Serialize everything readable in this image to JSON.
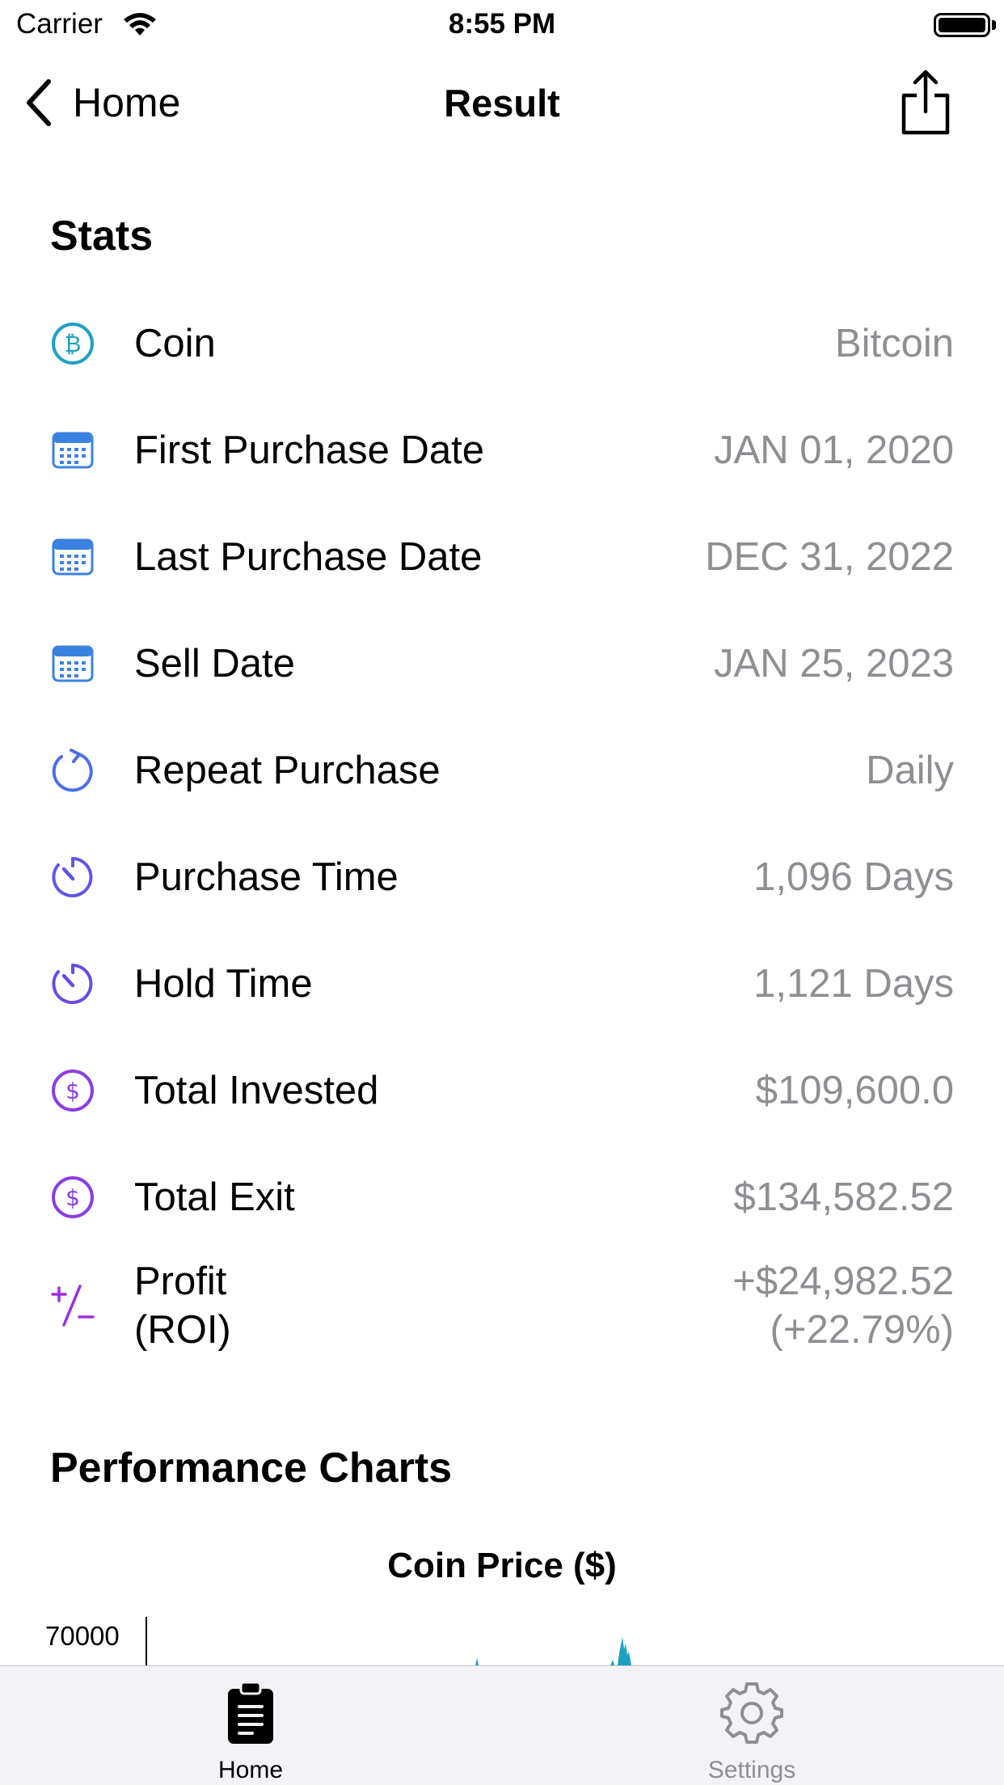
{
  "status_bar": {
    "carrier": "Carrier",
    "time": "8:55 PM"
  },
  "nav": {
    "back_label": "Home",
    "title": "Result"
  },
  "stats": {
    "title": "Stats",
    "rows": [
      {
        "icon": "bitcoin-icon",
        "label": "Coin",
        "value": "Bitcoin"
      },
      {
        "icon": "calendar-icon",
        "label": "First Purchase Date",
        "value": "JAN 01, 2020"
      },
      {
        "icon": "calendar-icon",
        "label": "Last Purchase Date",
        "value": "DEC 31, 2022"
      },
      {
        "icon": "calendar-icon",
        "label": "Sell Date",
        "value": "JAN 25, 2023"
      },
      {
        "icon": "repeat-icon",
        "label": "Repeat Purchase",
        "value": "Daily"
      },
      {
        "icon": "timer-icon",
        "label": "Purchase Time",
        "value": "1,096 Days"
      },
      {
        "icon": "timer-icon",
        "label": "Hold Time",
        "value": "1,121 Days"
      },
      {
        "icon": "dollar-circle-icon",
        "label": "Total Invested",
        "value": "$109,600.0"
      },
      {
        "icon": "dollar-circle-icon",
        "label": "Total Exit",
        "value": "$134,582.52"
      },
      {
        "icon": "plus-minus-icon",
        "label_line1": "Profit",
        "label_line2": "(ROI)",
        "value_line1": "+$24,982.52",
        "value_line2": "(+22.79%)"
      }
    ]
  },
  "charts": {
    "title": "Performance Charts",
    "coin_price_title": "Coin Price ($)",
    "y_tick_top": "70000"
  },
  "tabs": [
    {
      "label": "Home",
      "icon": "clipboard-icon",
      "selected": true
    },
    {
      "label": "Settings",
      "icon": "gear-icon",
      "selected": false
    }
  ],
  "colors": {
    "bitcoin": "#1ea0c3",
    "calendar": "#3b82e0",
    "repeat": "#4a6ee8",
    "timer": "#5e55e6",
    "dollar": "#8a3de0",
    "plusminus": "#9a2ee0",
    "value_gray": "#8e8e93",
    "tab_inactive": "#8e8e93"
  }
}
